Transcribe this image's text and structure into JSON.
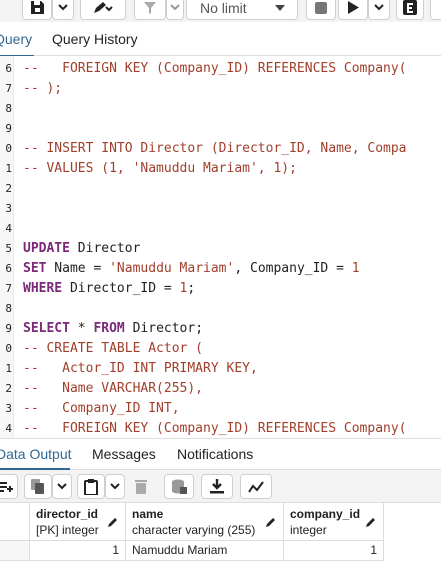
{
  "toolbar": {
    "limit_label": "No limit",
    "icons": [
      "save-icon",
      "chevron-down-icon",
      "pen-icon",
      "filter-icon",
      "stop-icon",
      "play-icon",
      "explain-icon"
    ]
  },
  "tabs": [
    {
      "label": "Query",
      "active": true
    },
    {
      "label": "Query History",
      "active": false
    }
  ],
  "editor": {
    "lines": [
      {
        "n": "6",
        "segs": [
          {
            "t": "--   FOREIGN KEY (Company_ID) REFERENCES Company(",
            "c": "cm"
          }
        ]
      },
      {
        "n": "7",
        "segs": [
          {
            "t": "-- );",
            "c": "cm"
          }
        ]
      },
      {
        "n": "8",
        "segs": []
      },
      {
        "n": "9",
        "segs": []
      },
      {
        "n": "0",
        "segs": [
          {
            "t": "-- INSERT INTO Director (Director_ID, Name, Compa",
            "c": "cm"
          }
        ]
      },
      {
        "n": "1",
        "segs": [
          {
            "t": "-- VALUES (1, 'Namuddu Mariam', 1);",
            "c": "cm"
          }
        ]
      },
      {
        "n": "2",
        "segs": []
      },
      {
        "n": "3",
        "segs": []
      },
      {
        "n": "4",
        "segs": []
      },
      {
        "n": "5",
        "segs": [
          {
            "t": "UPDATE",
            "c": "kw"
          },
          {
            "t": " Director",
            "c": ""
          }
        ]
      },
      {
        "n": "6",
        "segs": [
          {
            "t": "SET",
            "c": "kw"
          },
          {
            "t": " Name = ",
            "c": ""
          },
          {
            "t": "'Namuddu Mariam'",
            "c": "str"
          },
          {
            "t": ", Company_ID = ",
            "c": ""
          },
          {
            "t": "1",
            "c": "num"
          }
        ]
      },
      {
        "n": "7",
        "segs": [
          {
            "t": "WHERE",
            "c": "kw"
          },
          {
            "t": " Director_ID = ",
            "c": ""
          },
          {
            "t": "1",
            "c": "num"
          },
          {
            "t": ";",
            "c": ""
          }
        ]
      },
      {
        "n": "8",
        "segs": []
      },
      {
        "n": "9",
        "segs": [
          {
            "t": "SELECT",
            "c": "kw"
          },
          {
            "t": " * ",
            "c": ""
          },
          {
            "t": "FROM",
            "c": "kw"
          },
          {
            "t": " Director;",
            "c": ""
          }
        ]
      },
      {
        "n": "0",
        "segs": [
          {
            "t": "-- CREATE TABLE Actor (",
            "c": "cm"
          }
        ]
      },
      {
        "n": "1",
        "segs": [
          {
            "t": "--   Actor_ID INT PRIMARY KEY,",
            "c": "cm"
          }
        ]
      },
      {
        "n": "2",
        "segs": [
          {
            "t": "--   Name VARCHAR(255),",
            "c": "cm"
          }
        ]
      },
      {
        "n": "3",
        "segs": [
          {
            "t": "--   Company_ID INT,",
            "c": "cm"
          }
        ]
      },
      {
        "n": "4",
        "segs": [
          {
            "t": "--   FOREIGN KEY (Company_ID) REFERENCES Company(",
            "c": "cm"
          }
        ]
      }
    ]
  },
  "results": {
    "tabs": [
      {
        "label": "Data Output",
        "active": true
      },
      {
        "label": "Messages",
        "active": false
      },
      {
        "label": "Notifications",
        "active": false
      }
    ],
    "toolbar_icons": [
      "add-row-icon",
      "copy-icon",
      "chevron-down-icon",
      "paste-icon",
      "chevron-down-icon",
      "delete-icon",
      "save-data-icon",
      "download-icon",
      "graph-icon"
    ],
    "columns": [
      {
        "name": "director_id",
        "type": "[PK] integer"
      },
      {
        "name": "name",
        "type": "character varying (255)"
      },
      {
        "name": "company_id",
        "type": "integer"
      }
    ],
    "rows": [
      {
        "director_id": "1",
        "name": "Namuddu Mariam",
        "company_id": "1"
      }
    ]
  }
}
